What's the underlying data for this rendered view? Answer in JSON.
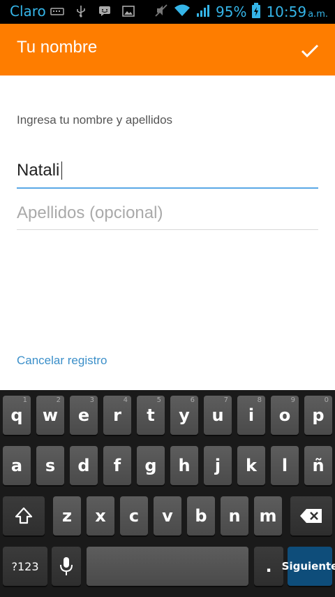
{
  "status_bar": {
    "carrier": "Claro",
    "battery_percent": "95%",
    "time": "10:59",
    "ampm": "a.m."
  },
  "app_bar": {
    "title": "Tu nombre",
    "confirm_icon": "check-icon"
  },
  "form": {
    "prompt": "Ingresa tu nombre y apellidos",
    "first_name_value": "Natali",
    "last_name_placeholder": "Apellidos (opcional)",
    "cancel_label": "Cancelar registro"
  },
  "keyboard": {
    "row1": [
      "q",
      "w",
      "e",
      "r",
      "t",
      "y",
      "u",
      "i",
      "o",
      "p"
    ],
    "row1_hints": [
      "1",
      "2",
      "3",
      "4",
      "5",
      "6",
      "7",
      "8",
      "9",
      "0"
    ],
    "row2": [
      "a",
      "s",
      "d",
      "f",
      "g",
      "h",
      "j",
      "k",
      "l",
      "ñ"
    ],
    "row3": [
      "z",
      "x",
      "c",
      "v",
      "b",
      "n",
      "m"
    ],
    "symbols_label": "?123",
    "period_label": ".",
    "action_label": "Siguiente",
    "accent_color": "#0e4d7a"
  },
  "colors": {
    "app_bar": "#fe7d00",
    "status_text": "#35b5e8",
    "field_focus_line": "#5aa8e6",
    "link": "#3b8fc9"
  }
}
